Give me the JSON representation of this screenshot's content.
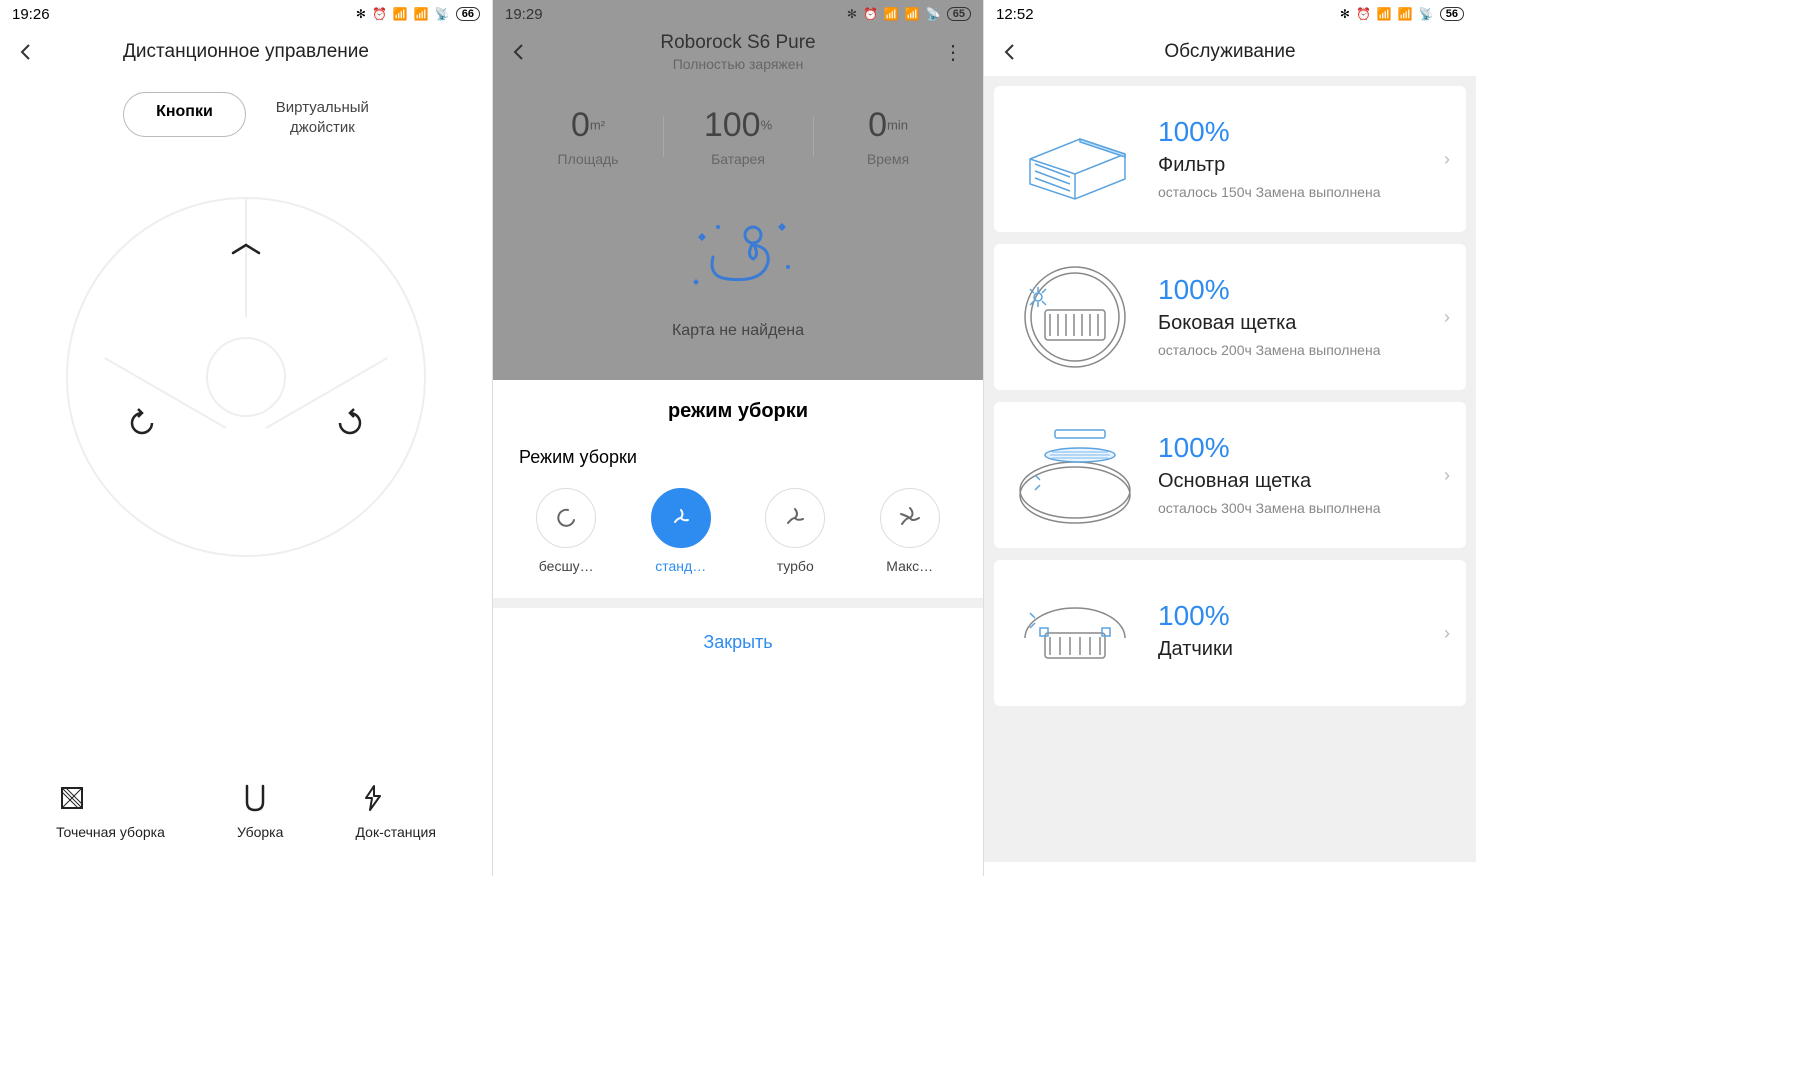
{
  "screen1": {
    "status": {
      "time": "19:26",
      "battery": "66"
    },
    "header": {
      "title": "Дистанционное управление"
    },
    "modes": {
      "buttons": "Кнопки",
      "joystick": "Виртуальный\nджойстик"
    },
    "actions": {
      "spot": "Точечная уборка",
      "clean": "Уборка",
      "dock": "Док-станция"
    }
  },
  "screen2": {
    "status": {
      "time": "19:29",
      "battery": "65"
    },
    "header": {
      "title": "Roborock S6 Pure",
      "subtitle": "Полностью заряжен"
    },
    "stats": {
      "area": {
        "value": "0",
        "unit": "m²",
        "label": "Площадь"
      },
      "battery": {
        "value": "100",
        "unit": "%",
        "label": "Батарея"
      },
      "time": {
        "value": "0",
        "unit": "min",
        "label": "Время"
      }
    },
    "map_msg": "Карта не найдена",
    "sheet_title": "режим уборки",
    "sheet_sub": "Режим уборки",
    "modes": {
      "silent": "бесшу…",
      "standard": "станд…",
      "turbo": "турбо",
      "max": "Макс…"
    },
    "close": "Закрыть"
  },
  "screen3": {
    "status": {
      "time": "12:52",
      "battery": "56"
    },
    "header": {
      "title": "Обслуживание"
    },
    "items": [
      {
        "pct": "100%",
        "name": "Фильтр",
        "desc": "осталось 150ч Замена выполнена"
      },
      {
        "pct": "100%",
        "name": "Боковая щетка",
        "desc": "осталось 200ч Замена выполнена"
      },
      {
        "pct": "100%",
        "name": "Основная щетка",
        "desc": "осталось 300ч Замена выполнена"
      },
      {
        "pct": "100%",
        "name": "Датчики",
        "desc": ""
      }
    ]
  }
}
